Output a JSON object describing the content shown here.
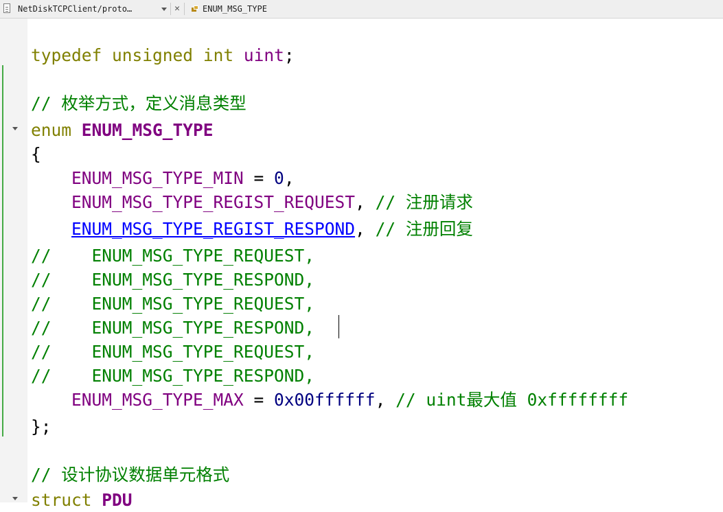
{
  "toolbar": {
    "file_label": "NetDiskTCPClient/proto…",
    "close_glyph": "✕",
    "symbol_label": "ENUM_MSG_TYPE"
  },
  "code": {
    "l1": {
      "kw1": "typedef",
      "kw2": "unsigned",
      "kw3": "int",
      "id": "uint",
      "p": ";"
    },
    "l3": {
      "c": "// 枚举方式，定义消息类型"
    },
    "l4": {
      "kw": "enum",
      "name": "ENUM_MSG_TYPE"
    },
    "l5": {
      "p": "{"
    },
    "l6": {
      "id": "ENUM_MSG_TYPE_MIN",
      "op": " = ",
      "num": "0",
      "p": ","
    },
    "l7": {
      "id": "ENUM_MSG_TYPE_REGIST_REQUEST",
      "p": ",",
      "c": "// 注册请求"
    },
    "l8": {
      "id": "ENUM_MSG_TYPE_REGIST_RESPOND",
      "p": ",",
      "c": "// 注册回复"
    },
    "l9": {
      "c": "//    ENUM_MSG_TYPE_REQUEST,"
    },
    "l10": {
      "c": "//    ENUM_MSG_TYPE_RESPOND,"
    },
    "l11": {
      "c": "//    ENUM_MSG_TYPE_REQUEST,"
    },
    "l12": {
      "c": "//    ENUM_MSG_TYPE_RESPOND,"
    },
    "l13": {
      "c": "//    ENUM_MSG_TYPE_REQUEST,"
    },
    "l14": {
      "c": "//    ENUM_MSG_TYPE_RESPOND,"
    },
    "l15": {
      "id": "ENUM_MSG_TYPE_MAX",
      "op": " = ",
      "num": "0x00ffffff",
      "p": ",",
      "c": "// uint最大值 0xffffffff"
    },
    "l16": {
      "p": "};"
    },
    "l18": {
      "c": "// 设计协议数据单元格式"
    },
    "l19": {
      "kw": "struct",
      "name": "PDU"
    }
  },
  "colors": {
    "keyword": "#808000",
    "identifier": "#800080",
    "comment": "#008000",
    "number": "#000080",
    "link": "#0000ff",
    "change_bar": "#44aa44"
  },
  "icons": [
    "file-icon",
    "dropdown-arrow-icon",
    "close-icon",
    "enum-icon",
    "fold-arrow-icon"
  ]
}
